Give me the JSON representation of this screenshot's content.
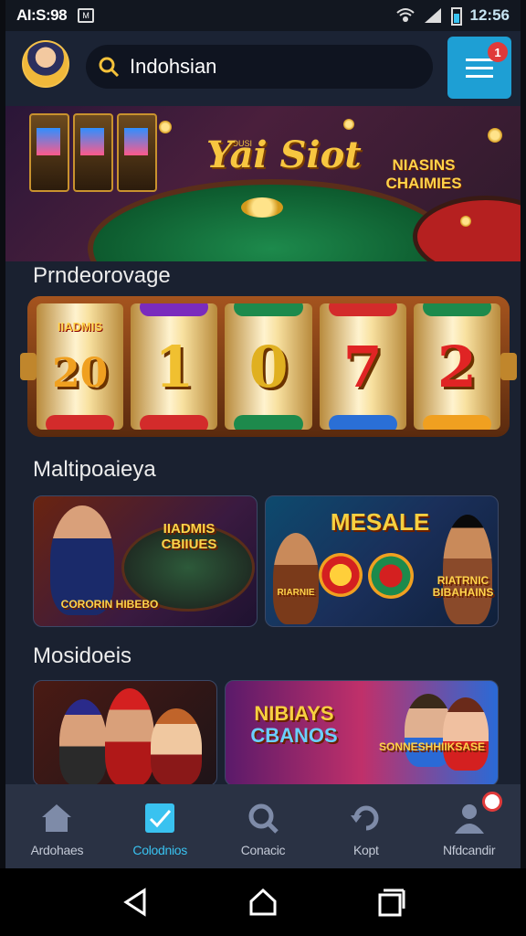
{
  "status": {
    "time": "AI:S:98",
    "clock": "12:56",
    "notif": "M"
  },
  "search": {
    "value": "Indohsian"
  },
  "menu": {
    "badge": "1"
  },
  "banner": {
    "title": "Yai Siot",
    "title_small": "OUSI",
    "promo_line1": "NIASINS",
    "promo_line2": "CHAIMIES"
  },
  "sections": {
    "promo": "Prndeorovage",
    "multi": "Maltipoaieya",
    "more": "Mosidoeis"
  },
  "slot": {
    "tag": "IIADMIS",
    "reels": [
      "20",
      "1",
      "0",
      "7",
      "2"
    ]
  },
  "cards": {
    "c1_line1": "IIADMIS",
    "c1_line2": "CBIIUES",
    "c1_bottom": "CORORIN HIBEBO",
    "c2_title": "MESALE",
    "c2_line1": "RIATRNIC",
    "c2_line2": "BIBAHAINS",
    "c2_left": "RIARNIE",
    "c3_title": "",
    "c4_line1": "NIBIAYS",
    "c4_line2": "CBANOS",
    "c4_line3": "SONNESHHIIKSASE"
  },
  "bottom_nav": [
    {
      "label": "Ardohaes",
      "icon": "home-icon"
    },
    {
      "label": "Colodnios",
      "icon": "check-icon",
      "active": true
    },
    {
      "label": "Conacic",
      "icon": "search-icon"
    },
    {
      "label": "Kopt",
      "icon": "refresh-icon"
    },
    {
      "label": "Nfdcandir",
      "icon": "profile-icon",
      "badge": true
    }
  ],
  "colors": {
    "accent": "#1e9fd4",
    "gold": "#f7c640",
    "nav_active": "#39c2f0",
    "badge": "#e03a3a"
  }
}
